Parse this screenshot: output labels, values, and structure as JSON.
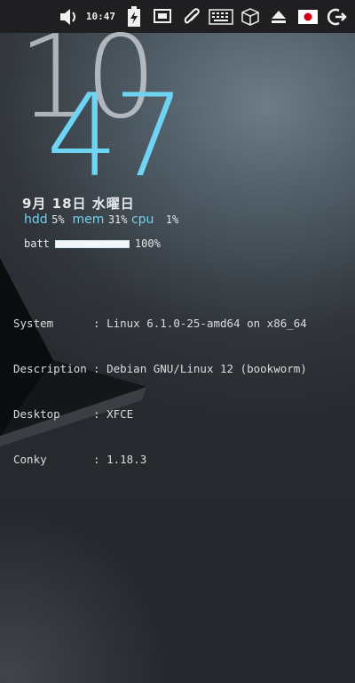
{
  "panel": {
    "clock": "10:47",
    "icons": [
      "volume-icon",
      "battery-charging-icon",
      "network-wired-icon",
      "paperclip-icon",
      "keyboard-icon",
      "package-box-icon",
      "eject-icon",
      "japan-flag-icon",
      "logout-icon"
    ],
    "colors": {
      "background": "#1f1f21",
      "icon": "#f0f0f0"
    }
  },
  "conky": {
    "hour": "10",
    "minute": "47",
    "date": "9月 18日 水曜日",
    "hdd_label": "hdd",
    "hdd_value": "5%",
    "mem_label": "mem",
    "mem_value": "31%",
    "cpu_label": "cpu",
    "cpu_value": "1%",
    "batt_label": "batt",
    "batt_value": "100%",
    "batt_level": 1.0,
    "accent_color": "#6fd3f2"
  },
  "sysinfo": [
    {
      "label": "System",
      "value": "Linux 6.1.0-25-amd64 on x86_64"
    },
    {
      "label": "Description",
      "value": "Debian GNU/Linux 12 (bookworm)"
    },
    {
      "label": "Desktop",
      "value": "XFCE"
    },
    {
      "label": "Conky",
      "value": "1.18.3"
    }
  ]
}
